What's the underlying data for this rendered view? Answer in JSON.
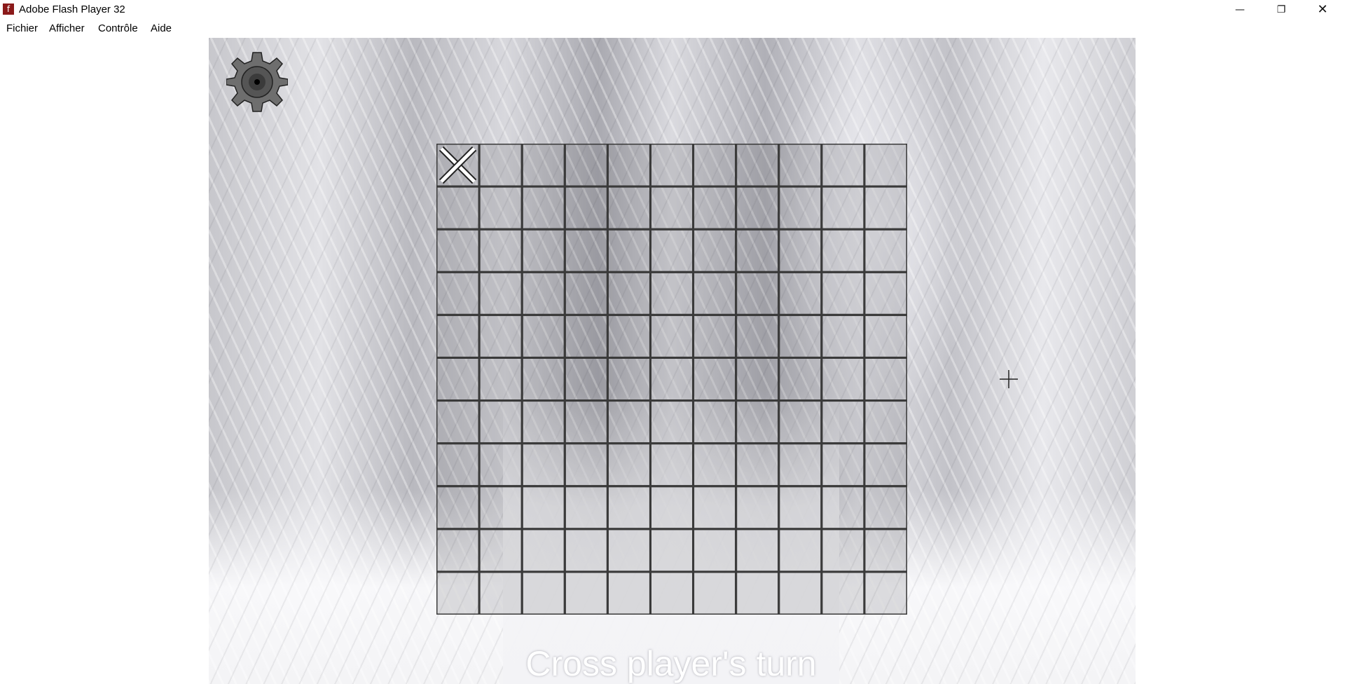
{
  "window": {
    "title": "Adobe Flash Player 32",
    "app_icon_glyph": "f",
    "minimize_glyph": "—",
    "maximize_glyph": "❐",
    "close_glyph": "✕"
  },
  "menu": {
    "items": [
      "Fichier",
      "Afficher",
      "Contrôle",
      "Aide"
    ]
  },
  "game": {
    "settings_icon": "gear-icon",
    "board": {
      "rows": 11,
      "cols": 11,
      "marks": [
        {
          "row": 0,
          "col": 0,
          "symbol": "X"
        }
      ],
      "line_color": "#3a3a3a",
      "cell_tint": "rgba(90,90,95,0.18)"
    },
    "status": "Cross player's turn"
  },
  "colors": {
    "titlebar_bg": "#ffffff",
    "app_icon_bg": "#8b1a1a",
    "gear_fill": "#6e6e6e",
    "mark_color": "#ffffff"
  }
}
